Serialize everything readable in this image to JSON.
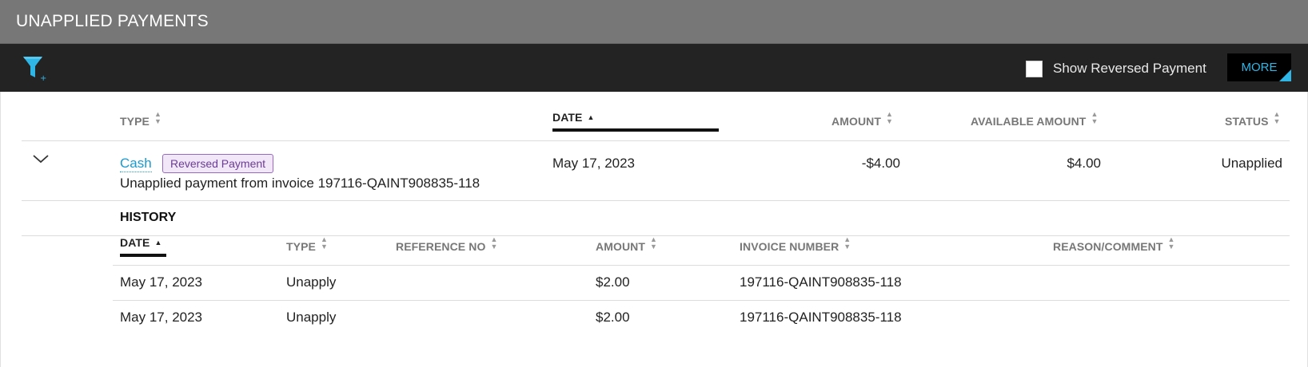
{
  "page": {
    "title": "UNAPPLIED PAYMENTS"
  },
  "toolbar": {
    "filter_icon": "filter-add-icon",
    "show_reversed_label": "Show Reversed Payment",
    "show_reversed_checked": false,
    "more_label": "MORE",
    "accent_color": "#2fb5e6"
  },
  "payments_table": {
    "headers": {
      "type": "TYPE",
      "date": "DATE",
      "amount": "AMOUNT",
      "available_amount": "AVAILABLE AMOUNT",
      "status": "STATUS"
    },
    "sorted_by": "DATE",
    "rows": [
      {
        "type": "Cash",
        "badge": "Reversed Payment",
        "description": "Unapplied payment from invoice 197116-QAINT908835-118",
        "date": "May 17, 2023",
        "amount": "-$4.00",
        "available_amount": "$4.00",
        "status": "Unapplied",
        "expanded": true
      }
    ]
  },
  "history": {
    "title": "HISTORY",
    "headers": {
      "date": "DATE",
      "type": "TYPE",
      "reference_no": "REFERENCE NO",
      "amount": "AMOUNT",
      "invoice_number": "INVOICE NUMBER",
      "reason_comment": "REASON/COMMENT"
    },
    "sorted_by": "DATE",
    "rows": [
      {
        "date": "May 17, 2023",
        "type": "Unapply",
        "reference_no": "",
        "amount": "$2.00",
        "invoice_number": "197116-QAINT908835-118",
        "reason_comment": ""
      },
      {
        "date": "May 17, 2023",
        "type": "Unapply",
        "reference_no": "",
        "amount": "$2.00",
        "invoice_number": "197116-QAINT908835-118",
        "reason_comment": ""
      }
    ]
  }
}
